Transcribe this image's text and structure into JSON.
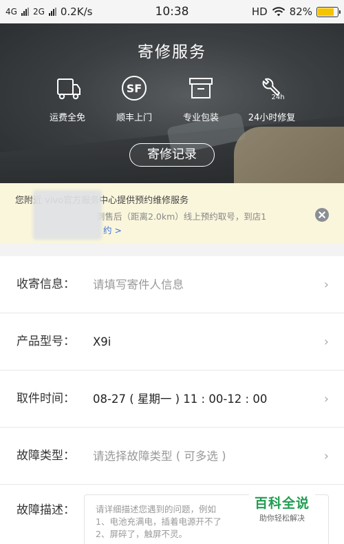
{
  "status_bar": {
    "network_1": "4G",
    "network_2": "2G",
    "speed": "0.2K/s",
    "time": "10:38",
    "hd": "HD",
    "battery_percent": "82%",
    "battery_level": 0.82,
    "battery_color": "#f5c400"
  },
  "hero": {
    "title": "寄修服务",
    "features": [
      {
        "label": "运费全免",
        "icon": "truck-icon"
      },
      {
        "label": "顺丰上门",
        "icon": "sf-express-icon"
      },
      {
        "label": "专业包装",
        "icon": "box-icon"
      },
      {
        "label": "24小时修复",
        "icon": "wrench-24h-icon",
        "badge": "24h"
      }
    ],
    "sf_mark": "SF",
    "record_button": "寄修记录"
  },
  "notice": {
    "line1": "您附近 vivo官方服务中心提供预约维修服务",
    "line2": "到售后（距离2.0km）线上预约取号，到店1",
    "link": "约 >",
    "bg_color": "#faf6dc",
    "link_color": "#3b6fd8"
  },
  "form": {
    "rows": [
      {
        "label": "收寄信息：",
        "value": "请填写寄件人信息",
        "placeholder": true
      },
      {
        "label": "产品型号：",
        "value": "X9i",
        "placeholder": false
      },
      {
        "label": "取件时间：",
        "value": "08-27 ( 星期一 ) 11 : 00-12 : 00",
        "placeholder": false
      },
      {
        "label": "故障类型：",
        "value": "请选择故障类型 ( 可多选 )",
        "placeholder": true
      }
    ],
    "description_label": "故障描述：",
    "description_placeholder": "请详细描述您遇到的问题，例如\n1、电池充满电，插着电源开不了\n2、屏碎了，触屏不灵。"
  },
  "watermark": {
    "title": "百科全说",
    "subtitle": "助你轻松解决",
    "color": "#1f9d4f"
  }
}
